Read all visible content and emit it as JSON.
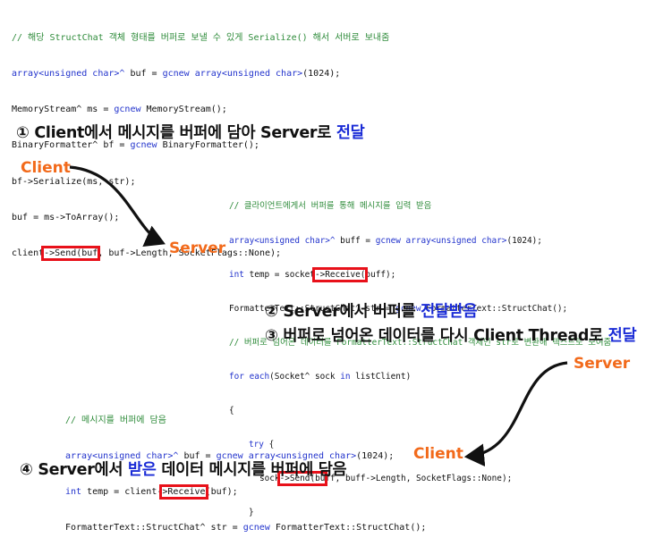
{
  "block1": {
    "comment": "// 해당 StructChat 객체 형태를 버퍼로 보낼 수 있게 Serialize() 해서 서버로 보내줌",
    "l1a": "array<unsigned char>^",
    "l1b": " buf = ",
    "l1c": "gcnew array<unsigned char>",
    "l1d": "(1024);",
    "l2a": "MemoryStream^ ms = ",
    "l2b": "gcnew",
    "l2c": " MemoryStream();",
    "l3a": "BinaryFormatter^ bf = ",
    "l3b": "gcnew",
    "l3c": " BinaryFormatter();",
    "l4": "bf->Serialize(ms, str);",
    "l5": "buf = ms->ToArray();",
    "l6a": "client",
    "l6b": "->Send(buf",
    "l6c": ", buf->Length, SocketFlags::None);"
  },
  "step1": {
    "num": "①",
    "a": "Client에서 메시지를 버퍼에 담아 Server로 ",
    "b": "전달"
  },
  "actors": {
    "client_top": "Client",
    "server_mid": "Server",
    "server_right": "Server",
    "client_bottom": "Client"
  },
  "block2": {
    "comment1": "// 클라이언트에게서 버퍼를 통해 메시지를 입력 받음",
    "l1a": "array<unsigned char>^",
    "l1b": " buff = ",
    "l1c": "gcnew array<unsigned char>",
    "l1d": "(1024);",
    "l2a": "int",
    "l2b": " temp = socket",
    "l2c": "->Receive(",
    "l2d": "buff);",
    "l3a": "FormatterText::StructChat^ str = ",
    "l3b": "gcnew",
    "l3c": " FormatterText::StructChat();",
    "comment2": "// 버퍼로 넘어온 데이터를 FormatterText::StructChat 객체인 str로 변환해 텍스트로 보여줌",
    "l4a": "for each",
    "l4b": "(Socket^ sock ",
    "l4c": "in",
    "l4d": " listClient)",
    "l5": "{",
    "l6a": "try",
    "l6b": " {",
    "l7a": "sock",
    "l7b": "->Send(bu",
    "l7c": "ff, buff->Length, SocketFlags::None);",
    "l8": "}"
  },
  "step2": {
    "num": "②",
    "a": "Server에서 버퍼를 ",
    "b": "전달받음"
  },
  "step3": {
    "num": "③",
    "a": "버퍼로 넘어온 데이터를 다시 Client Thread로 ",
    "b": "전달"
  },
  "block3": {
    "comment": "// 메시지를 버퍼에 담음",
    "l1a": "array<unsigned char>^",
    "l1b": " buf = ",
    "l1c": "gcnew array<unsigned char>",
    "l1d": "(1024);",
    "l2a": "int",
    "l2b": " temp = client-",
    "l2c": ">Receive",
    "l2d": "(buf);",
    "l3a": "FormatterText::StructChat^ str = ",
    "l3b": "gcnew",
    "l3c": " FormatterText::StructChat();"
  },
  "step4": {
    "num": "④",
    "a": "Server에서 ",
    "b": "받은",
    "c": " 데이터 메시지를 버퍼에 담음"
  }
}
